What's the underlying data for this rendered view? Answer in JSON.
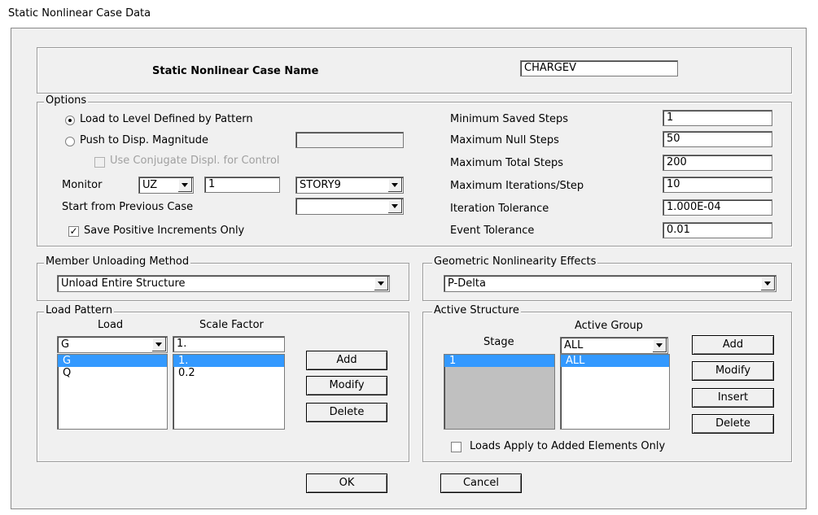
{
  "window": {
    "title": "Static Nonlinear Case  Data"
  },
  "case_name": {
    "label": "Static Nonlinear Case  Name",
    "value": "CHARGEV"
  },
  "options": {
    "legend": "Options",
    "radio_load_to_level": "Load to Level Defined by Pattern",
    "radio_push_to_disp": "Push to Disp. Magnitude",
    "push_disp_value": "",
    "use_conjugate": "Use Conjugate Displ. for Control",
    "monitor_label": "Monitor",
    "monitor_dof": "UZ",
    "monitor_point": "1",
    "monitor_story": "STORY9",
    "start_from_previous_label": "Start from Previous Case",
    "start_from_previous_value": "",
    "save_positive_label": "Save Positive Increments Only",
    "min_saved_steps_label": "Minimum Saved Steps",
    "min_saved_steps": "1",
    "max_null_steps_label": "Maximum Null Steps",
    "max_null_steps": "50",
    "max_total_steps_label": "Maximum Total Steps",
    "max_total_steps": "200",
    "max_iterations_label": "Maximum Iterations/Step",
    "max_iterations": "10",
    "iteration_tolerance_label": "Iteration Tolerance",
    "iteration_tolerance": "1.000E-04",
    "event_tolerance_label": "Event Tolerance",
    "event_tolerance": "0.01"
  },
  "member_unloading": {
    "legend": "Member Unloading Method",
    "value": "Unload Entire Structure"
  },
  "geometric_nonlinearity": {
    "legend": "Geometric Nonlinearity Effects",
    "value": "P-Delta"
  },
  "load_pattern": {
    "legend": "Load Pattern",
    "load_header": "Load",
    "scale_header": "Scale Factor",
    "load_select": "G",
    "scale_input": "1.",
    "rows": [
      {
        "load": "G",
        "scale": "1."
      },
      {
        "load": "Q",
        "scale": "0.2"
      }
    ],
    "add": "Add",
    "modify": "Modify",
    "delete": "Delete"
  },
  "active_structure": {
    "legend": "Active Structure",
    "stage_header": "Stage",
    "group_header": "Active Group",
    "group_select": "ALL",
    "rows": [
      {
        "stage": "1",
        "group": "ALL"
      }
    ],
    "add": "Add",
    "modify": "Modify",
    "insert": "Insert",
    "delete": "Delete",
    "loads_apply_label": "Loads Apply to Added Elements Only"
  },
  "footer": {
    "ok": "OK",
    "cancel": "Cancel"
  }
}
